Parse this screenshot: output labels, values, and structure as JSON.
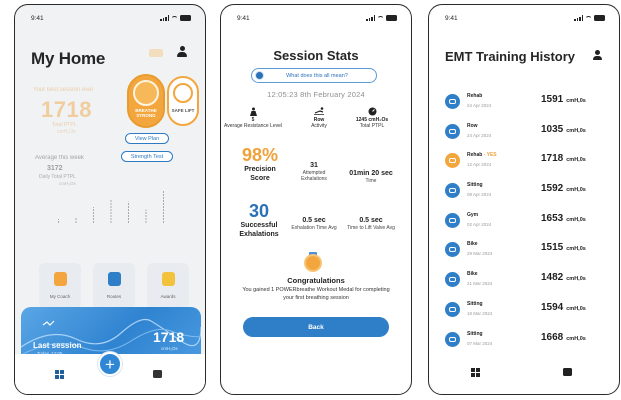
{
  "status_time": "9:41",
  "colors": {
    "accent_blue": "#2f7fc8",
    "accent_orange": "#f0a13a"
  },
  "home": {
    "title": "My Home",
    "max_label": "Your best session ever",
    "max_value": "1718",
    "max_sub": "Total PTPL",
    "max_sub2": "cmH₂Os",
    "medal1_label": "BREATHE STRONG",
    "medal2_label": "SAFE LIFT",
    "view_plan": "View Plan",
    "strength_test": "Strength Test",
    "avg_label": "Average this week",
    "avg_value": "3172",
    "avg_sub": "Daily Total PTPL",
    "avg_unit": "cmH₂Os",
    "mini_chart_values": [
      3,
      4,
      12,
      18,
      16,
      10,
      24
    ],
    "tiles": [
      {
        "label": "My Coach",
        "color": "#f3a63d"
      },
      {
        "label": "Routes",
        "color": "#2f7fc8"
      },
      {
        "label": "Awards",
        "color": "#f3c23d"
      }
    ],
    "last_session_label": "Last session",
    "last_session_sub": "Today, 12:05",
    "last_session_value": "1718",
    "last_session_unit": "cmH₂Os"
  },
  "stats": {
    "title": "Session Stats",
    "help_link": "What does this all mean?",
    "datetime": "12:05:23 8th February 2024",
    "resistance_value": "5",
    "resistance_label": "Average Resistance Level",
    "activity_value": "Row",
    "activity_label": "Activity",
    "ptpl_value": "1245 cmH₂Os",
    "ptpl_label": "Total PTPL",
    "precision_value": "98%",
    "precision_label_1": "Precision",
    "precision_label_2": "Score",
    "attempted_value": "31",
    "attempted_label": "Attempted Exhalations",
    "time_value": "01min 20 sec",
    "time_label": "Time",
    "successful_value": "30",
    "successful_label_1": "Successful",
    "successful_label_2": "Exhalations",
    "exh_time_value": "0.5 sec",
    "exh_time_label": "Exhalation Time Avg",
    "lift_time_value": "0.5 sec",
    "lift_time_label": "Time to Lift Valve Avg",
    "congrats_title": "Congratulations",
    "congrats_msg": "You gained 1 POWERbreathe Workout Medal for completing your first breathing session",
    "back_label": "Back"
  },
  "history": {
    "title": "EMT Training History",
    "rows": [
      {
        "name": "Rehab",
        "tag": "",
        "date": "24 Apr 2024",
        "value": "1591",
        "unit": "cmH,0s",
        "icon": "lungs-icon"
      },
      {
        "name": "Row",
        "tag": "",
        "date": "24 Apr 2024",
        "value": "1035",
        "unit": "cmH,0s",
        "icon": "rowing-icon"
      },
      {
        "name": "Rehab",
        "tag": " - YES",
        "date": "12 Apr 2024",
        "value": "1718",
        "unit": "cmH,0s",
        "icon": "lungs-icon"
      },
      {
        "name": "Sitting",
        "tag": "",
        "date": "08 Apr 2024",
        "value": "1592",
        "unit": "cmH,0s",
        "icon": "chair-icon"
      },
      {
        "name": "Gym",
        "tag": "",
        "date": "02 Apr 2024",
        "value": "1653",
        "unit": "cmH,0s",
        "icon": "dumbbell-icon"
      },
      {
        "name": "Bike",
        "tag": "",
        "date": "29 Mar 2024",
        "value": "1515",
        "unit": "cmH,0s",
        "icon": "bike-icon"
      },
      {
        "name": "Bike",
        "tag": "",
        "date": "21 Mar 2024",
        "value": "1482",
        "unit": "cmH,0s",
        "icon": "bike-icon"
      },
      {
        "name": "Sitting",
        "tag": "",
        "date": "18 Mar 2024",
        "value": "1594",
        "unit": "cmH,0s",
        "icon": "chair-icon"
      },
      {
        "name": "Sitting",
        "tag": "",
        "date": "07 Mar 2024",
        "value": "1668",
        "unit": "cmH,0s",
        "icon": "chair-icon"
      }
    ]
  }
}
